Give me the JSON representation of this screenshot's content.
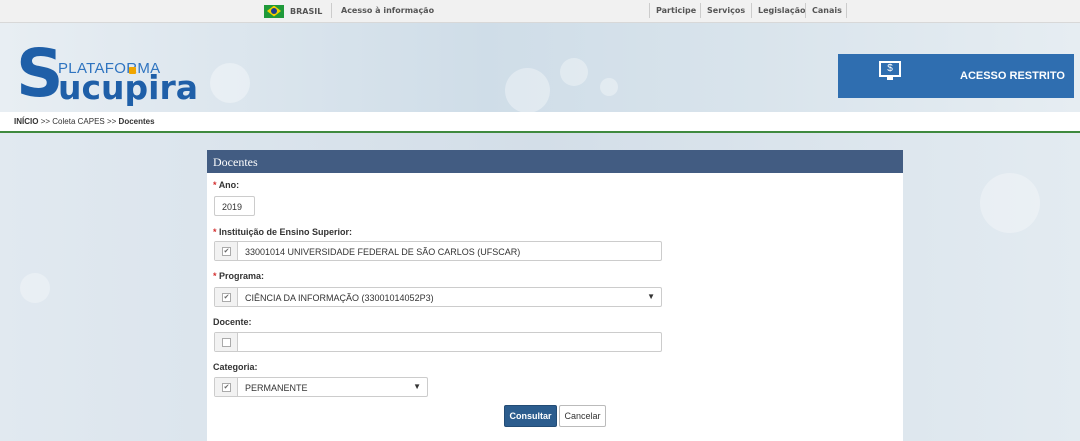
{
  "govbar": {
    "brasil_label": "BRASIL",
    "acesso_label": "Acesso à informação",
    "links": [
      "Participe",
      "Serviços",
      "Legislação",
      "Canais"
    ]
  },
  "header": {
    "logo_prefix": "S",
    "logo_plataforma": "PLATAFORMA",
    "logo_name": "ucupira",
    "restrito_icon": "$",
    "restrito_label": "ACESSO RESTRITO"
  },
  "breadcrumb": {
    "inicio": "INÍCIO",
    "sep1": ">>",
    "coleta": "Coleta CAPES",
    "sep2": ">>",
    "current": "Docentes"
  },
  "form": {
    "title": "Docentes",
    "required_mark": "*",
    "ano": {
      "label": "Ano:",
      "value": "2019"
    },
    "instituicao": {
      "label": "Instituição de Ensino Superior:",
      "value": "33001014 UNIVERSIDADE FEDERAL DE SÃO CARLOS (UFSCAR)",
      "checked": true
    },
    "programa": {
      "label": "Programa:",
      "value": "CIÊNCIA DA INFORMAÇÃO (33001014052P3)",
      "checked": true
    },
    "docente": {
      "label": "Docente:",
      "value": "",
      "checked": false
    },
    "categoria": {
      "label": "Categoria:",
      "value": "PERMANENTE",
      "checked": true
    },
    "consultar_label": "Consultar",
    "cancelar_label": "Cancelar"
  },
  "colors": {
    "panel_header": "#425c82",
    "primary_button": "#2c5d8e",
    "restrito_bg": "#2f6eb0",
    "breadcrumb_line": "#3f8a3f",
    "required": "#d32f2f"
  }
}
